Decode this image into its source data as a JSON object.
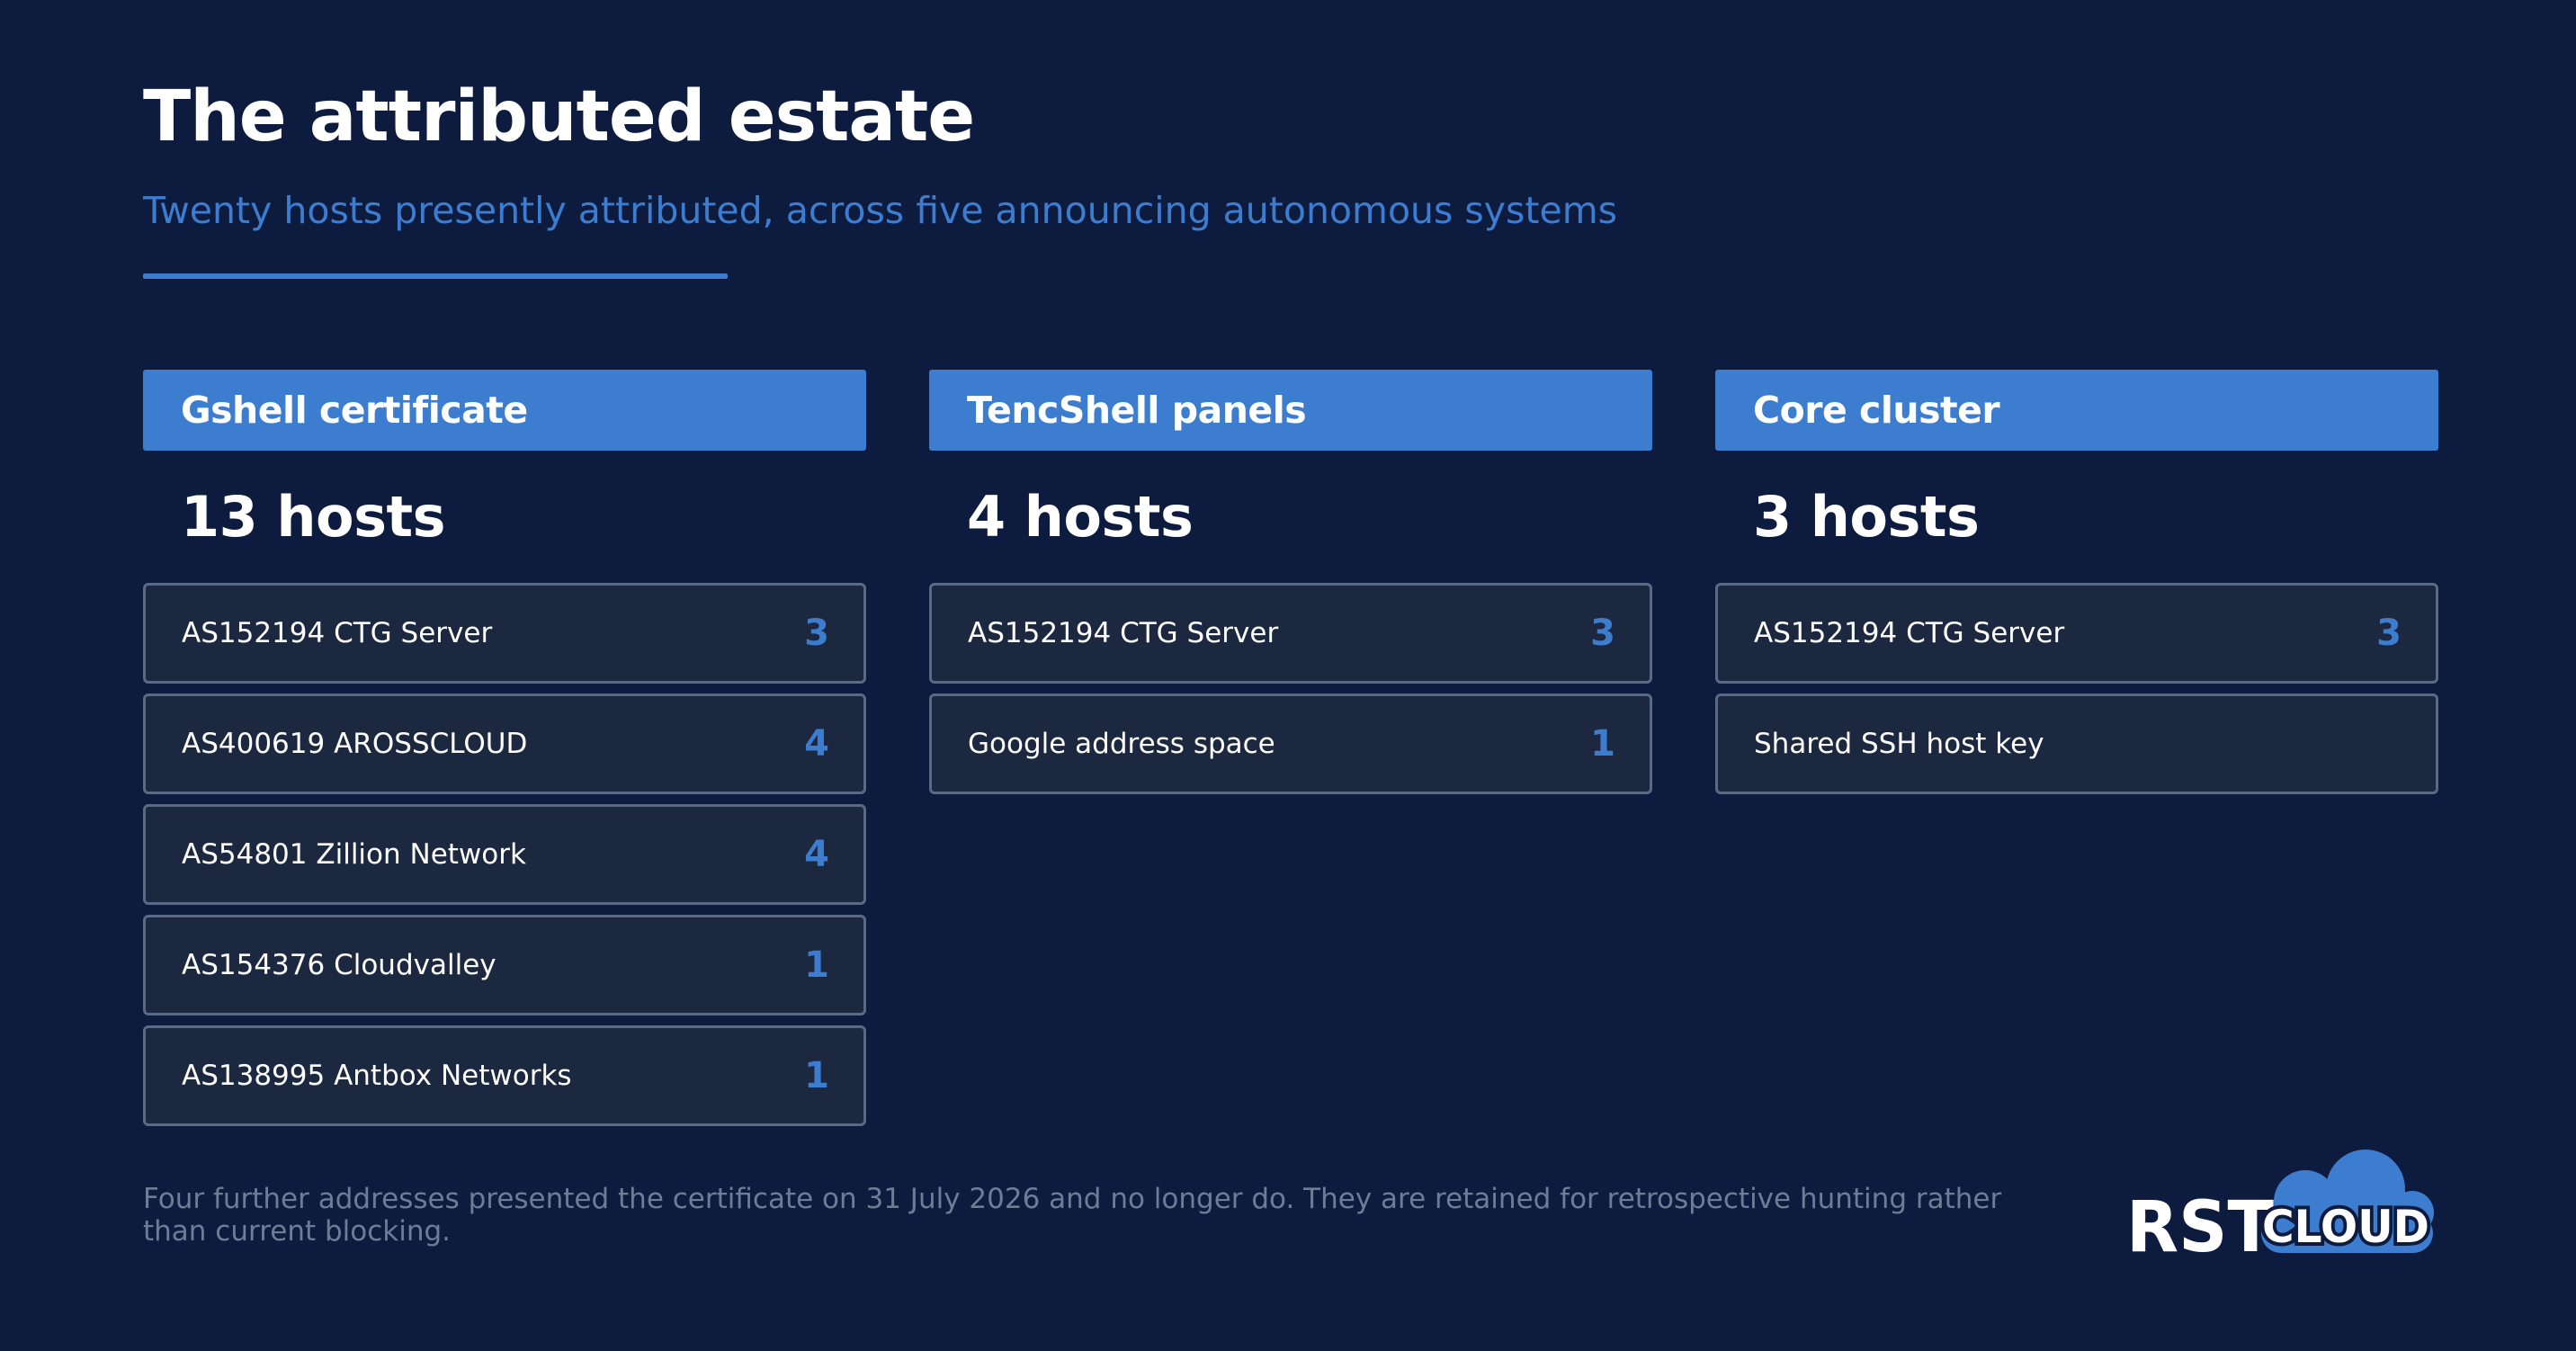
{
  "header": {
    "title": "The attributed estate",
    "subtitle": "Twenty hosts presently attributed, across five announcing autonomous systems"
  },
  "columns": [
    {
      "title": "Gshell certificate",
      "count_label": "13 hosts",
      "rows": [
        {
          "label": "AS152194  CTG Server",
          "count": "3"
        },
        {
          "label": "AS400619  AROSSCLOUD",
          "count": "4"
        },
        {
          "label": "AS54801  Zillion Network",
          "count": "4"
        },
        {
          "label": "AS154376  Cloudvalley",
          "count": "1"
        },
        {
          "label": "AS138995  Antbox Networks",
          "count": "1"
        }
      ]
    },
    {
      "title": "TencShell panels",
      "count_label": "4 hosts",
      "rows": [
        {
          "label": "AS152194  CTG Server",
          "count": "3"
        },
        {
          "label": "Google address space",
          "count": "1"
        }
      ]
    },
    {
      "title": "Core cluster",
      "count_label": "3 hosts",
      "rows": [
        {
          "label": "AS152194  CTG Server",
          "count": "3"
        },
        {
          "label": "Shared SSH host key",
          "count": ""
        }
      ]
    }
  ],
  "footnote": "Four further addresses presented the certificate on 31 July 2026 and no longer do. They are retained for retrospective hunting rather than current blocking.",
  "logo": {
    "wordmark": "RST",
    "cloud_text": "CLOUD"
  },
  "colors": {
    "background": "#0d1b3e",
    "accent": "#3d7dd0",
    "card": "#1b2840",
    "card_border": "#596a85",
    "muted_text": "#6e7c96"
  }
}
